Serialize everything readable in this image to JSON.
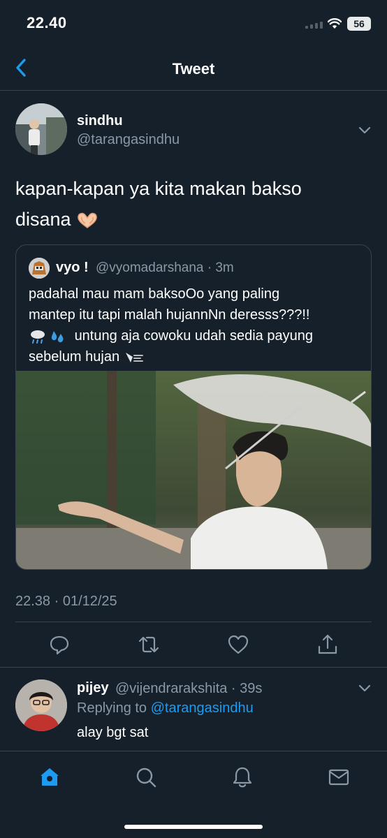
{
  "status_bar": {
    "time": "22.40",
    "battery": "56"
  },
  "nav": {
    "title": "Tweet"
  },
  "tweet": {
    "author_name": "sindhu",
    "author_handle": "@tarangasindhu",
    "text_line1": "kapan-kapan ya kita makan bakso",
    "text_line2": "disana",
    "timestamp": "22.38 · 01/12/25"
  },
  "quote": {
    "name": "vyo !",
    "meta": "@vyomadarshana · 3m",
    "lines": [
      "padahal mau mam baksoOo yang paling",
      "mantep itu tapi malah hujannNn deresss???!!",
      "untung aja cowoku udah sedia payung",
      "sebelum hujan"
    ]
  },
  "reply": {
    "name": "pijey",
    "meta": "@vijendrarakshita · 39s",
    "replying_prefix": "Replying to",
    "replying_mention": "@tarangasindhu",
    "text": "alay bgt sat"
  },
  "icons": {
    "actions": [
      "reply-icon",
      "retweet-icon",
      "like-icon",
      "share-icon"
    ],
    "tabs": [
      "home-icon",
      "search-icon",
      "notifications-icon",
      "messages-icon"
    ]
  },
  "colors": {
    "background": "#15202b",
    "accent": "#1d9bf0",
    "secondary_text": "#8b98a5",
    "border": "#38444d"
  }
}
